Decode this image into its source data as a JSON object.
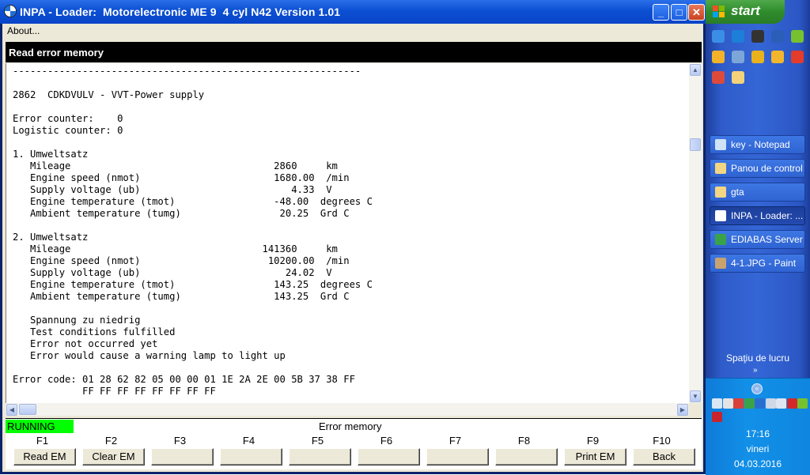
{
  "window": {
    "title": "INPA - Loader:  Motorelectronic ME 9  4 cyl N42 Version 1.01",
    "controls": {
      "minimize": "_",
      "maximize": "□",
      "close": "✕"
    }
  },
  "menu": {
    "about": "About..."
  },
  "panel": {
    "title": "Read error memory"
  },
  "output_text": "------------------------------------------------------------\n\n2862  CDKDVULV - VVT-Power supply\n\nError counter:    0\nLogistic counter: 0\n\n1. Umweltsatz\n   Mileage                                   2860     km\n   Engine speed (nmot)                       1680.00  /min\n   Supply voltage (ub)                          4.33  V\n   Engine temperature (tmot)                 -48.00  degrees C\n   Ambient temperature (tumg)                 20.25  Grd C\n\n2. Umweltsatz\n   Mileage                                 141360     km\n   Engine speed (nmot)                      10200.00  /min\n   Supply voltage (ub)                         24.02  V\n   Engine temperature (tmot)                 143.25  degrees C\n   Ambient temperature (tumg)                143.25  Grd C\n\n   Spannung zu niedrig\n   Test conditions fulfilled\n   Error not occurred yet\n   Error would cause a warning lamp to light up\n\nError code: 01 28 62 82 05 00 00 01 1E 2A 2E 00 5B 37 38 FF\n            FF FF FF FF FF FF FF FF",
  "status": {
    "state": "RUNNING",
    "text": "Error memory",
    "state_color": "#00ff00"
  },
  "function_keys": [
    {
      "key": "F1",
      "label": "Read EM"
    },
    {
      "key": "F2",
      "label": "Clear EM"
    },
    {
      "key": "F3",
      "label": ""
    },
    {
      "key": "F4",
      "label": ""
    },
    {
      "key": "F5",
      "label": ""
    },
    {
      "key": "F6",
      "label": ""
    },
    {
      "key": "F7",
      "label": ""
    },
    {
      "key": "F8",
      "label": ""
    },
    {
      "key": "F9",
      "label": "Print EM"
    },
    {
      "key": "F10",
      "label": "Back"
    }
  ],
  "taskbar": {
    "start": "start",
    "quick_launch": [
      {
        "icon": "ie-icon",
        "color": "#3a8ee6"
      },
      {
        "icon": "internet-explorer-icon",
        "color": "#1e7fd8"
      },
      {
        "icon": "camera-icon",
        "color": "#333333"
      },
      {
        "icon": "word-icon",
        "color": "#2b5eb7"
      },
      {
        "icon": "utorrent-icon",
        "color": "#78c12e"
      },
      {
        "icon": "smiley-icon",
        "color": "#f3b22a"
      },
      {
        "icon": "image-viewer-icon",
        "color": "#7ca6d8"
      },
      {
        "icon": "media-player-icon",
        "color": "#e9b21d"
      },
      {
        "icon": "kmplayer-icon",
        "color": "#f2b62d"
      },
      {
        "icon": "opera-icon",
        "color": "#e53b2b"
      },
      {
        "icon": "chrome-icon",
        "color": "#de4a3a"
      },
      {
        "icon": "folder-icon",
        "color": "#f2d37a"
      }
    ],
    "tasks": [
      {
        "label": "key - Notepad",
        "icon": "notepad-icon",
        "color": "#cfe3f7",
        "active": false
      },
      {
        "label": "Panou de control",
        "icon": "control-panel-folder-icon",
        "color": "#f4d583",
        "active": false
      },
      {
        "label": "gta",
        "icon": "folder-icon",
        "color": "#f4d583",
        "active": false
      },
      {
        "label": "INPA - Loader: ...",
        "icon": "bmw-icon",
        "color": "#ffffff",
        "active": true
      },
      {
        "label": "EDIABAS Server",
        "icon": "ediabas-icon",
        "color": "#3aa34a",
        "active": false
      },
      {
        "label": "4-1.JPG - Paint",
        "icon": "paint-icon",
        "color": "#c8a26e",
        "active": false
      }
    ],
    "workspace": "Spaţiu de lucru",
    "workspace_chevron": "»",
    "tray_collapse": "«",
    "tray_icons": [
      {
        "icon": "network-icon",
        "color": "#d9e6f3"
      },
      {
        "icon": "printer-icon",
        "color": "#e4e4e4"
      },
      {
        "icon": "shield-icon",
        "color": "#d8403a"
      },
      {
        "icon": "ediabas-tray-icon",
        "color": "#3aa34a"
      },
      {
        "icon": "bluetooth-icon",
        "color": "#2a6dd0"
      },
      {
        "icon": "usb-icon",
        "color": "#cfd8e6"
      },
      {
        "icon": "monitor-icon",
        "color": "#dde6f1"
      },
      {
        "icon": "bitdefender-icon",
        "color": "#d3282b"
      },
      {
        "icon": "utorrent-tray-icon",
        "color": "#78c12e"
      },
      {
        "icon": "antivirus-icon",
        "color": "#c8242c"
      }
    ],
    "clock": {
      "time": "17:16",
      "day": "vineri",
      "date": "04.03.2016"
    }
  }
}
